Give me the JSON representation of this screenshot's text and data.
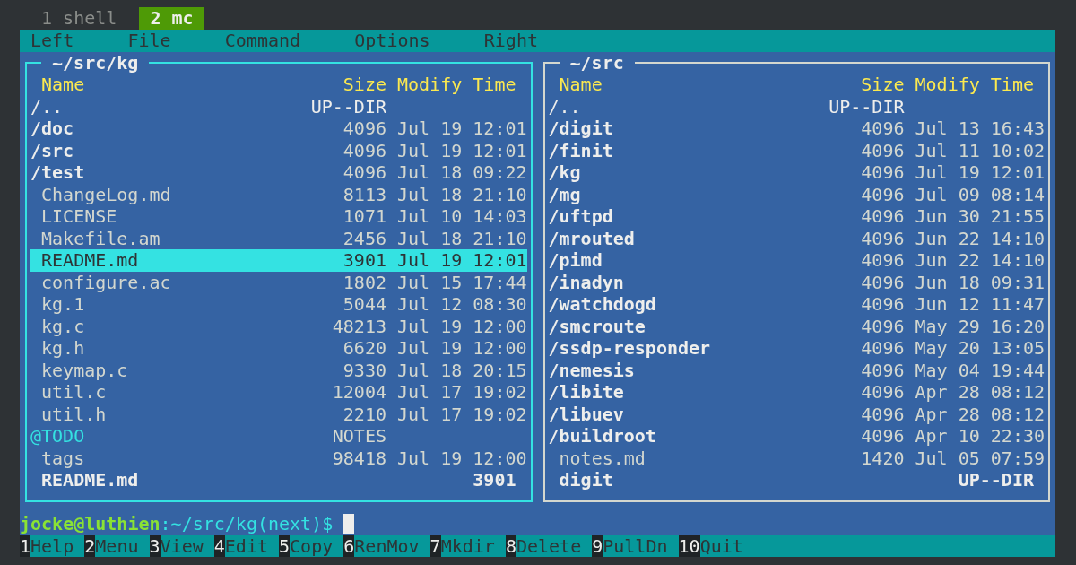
{
  "tabs": [
    {
      "label": "1 shell",
      "selected": false
    },
    {
      "label": "2 mc",
      "selected": true
    }
  ],
  "menu": [
    "Left",
    "File",
    "Command",
    "Options",
    "Right"
  ],
  "panels": [
    {
      "path": "~/src/kg",
      "active": true,
      "columns": [
        "Name",
        "Size",
        "Modify Time"
      ],
      "rows": [
        {
          "kind": "updir",
          "name": "/..",
          "size": "UP--DIR",
          "selected": false
        },
        {
          "kind": "dir",
          "name": "/doc",
          "size": "4096",
          "modified": "Jul 19 12:01",
          "selected": false
        },
        {
          "kind": "dir",
          "name": "/src",
          "size": "4096",
          "modified": "Jul 19 12:01",
          "selected": false
        },
        {
          "kind": "dir",
          "name": "/test",
          "size": "4096",
          "modified": "Jul 18 09:22",
          "selected": false
        },
        {
          "kind": "file",
          "name": "ChangeLog.md",
          "size": "8113",
          "modified": "Jul 18 21:10",
          "selected": false
        },
        {
          "kind": "file",
          "name": "LICENSE",
          "size": "1071",
          "modified": "Jul 10 14:03",
          "selected": false
        },
        {
          "kind": "file",
          "name": "Makefile.am",
          "size": "2456",
          "modified": "Jul 18 21:10",
          "selected": false
        },
        {
          "kind": "file",
          "name": "README.md",
          "size": "3901",
          "modified": "Jul 19 12:01",
          "selected": true
        },
        {
          "kind": "file",
          "name": "configure.ac",
          "size": "1802",
          "modified": "Jul 15 17:44",
          "selected": false
        },
        {
          "kind": "file",
          "name": "kg.1",
          "size": "5044",
          "modified": "Jul 12 08:30",
          "selected": false
        },
        {
          "kind": "file",
          "name": "kg.c",
          "size": "48213",
          "modified": "Jul 19 12:00",
          "selected": false
        },
        {
          "kind": "file",
          "name": "kg.h",
          "size": "6620",
          "modified": "Jul 19 12:00",
          "selected": false
        },
        {
          "kind": "file",
          "name": "keymap.c",
          "size": "9330",
          "modified": "Jul 18 20:15",
          "selected": false
        },
        {
          "kind": "file",
          "name": "util.c",
          "size": "12004",
          "modified": "Jul 17 19:02",
          "selected": false
        },
        {
          "kind": "file",
          "name": "util.h",
          "size": "2210",
          "modified": "Jul 17 19:02",
          "selected": false
        },
        {
          "kind": "special",
          "name": "@TODO",
          "size": "NOTES",
          "selected": false
        },
        {
          "kind": "file",
          "name": "tags",
          "size": "98418",
          "modified": "Jul 19 12:00",
          "selected": false
        }
      ],
      "mini_status": {
        "name": "README.md",
        "size": "3901"
      }
    },
    {
      "path": "~/src",
      "active": false,
      "columns": [
        "Name",
        "Size",
        "Modify Time"
      ],
      "rows": [
        {
          "kind": "updir",
          "name": "/..",
          "size": "UP--DIR",
          "selected": false
        },
        {
          "kind": "dir",
          "name": "/digit",
          "size": "4096",
          "modified": "Jul 13 16:43",
          "selected": false
        },
        {
          "kind": "dir",
          "name": "/finit",
          "size": "4096",
          "modified": "Jul 11 10:02",
          "selected": false
        },
        {
          "kind": "dir",
          "name": "/kg",
          "size": "4096",
          "modified": "Jul 19 12:01",
          "selected": false
        },
        {
          "kind": "dir",
          "name": "/mg",
          "size": "4096",
          "modified": "Jul 09 08:14",
          "selected": false
        },
        {
          "kind": "dir",
          "name": "/uftpd",
          "size": "4096",
          "modified": "Jun 30 21:55",
          "selected": false
        },
        {
          "kind": "dir",
          "name": "/mrouted",
          "size": "4096",
          "modified": "Jun 22 14:10",
          "selected": false
        },
        {
          "kind": "dir",
          "name": "/pimd",
          "size": "4096",
          "modified": "Jun 22 14:10",
          "selected": false
        },
        {
          "kind": "dir",
          "name": "/inadyn",
          "size": "4096",
          "modified": "Jun 18 09:31",
          "selected": false
        },
        {
          "kind": "dir",
          "name": "/watchdogd",
          "size": "4096",
          "modified": "Jun 12 11:47",
          "selected": false
        },
        {
          "kind": "dir",
          "name": "/smcroute",
          "size": "4096",
          "modified": "May 29 16:20",
          "selected": false
        },
        {
          "kind": "dir",
          "name": "/ssdp-responder",
          "size": "4096",
          "modified": "May 20 13:05",
          "selected": false
        },
        {
          "kind": "dir",
          "name": "/nemesis",
          "size": "4096",
          "modified": "May 04 19:44",
          "selected": false
        },
        {
          "kind": "dir",
          "name": "/libite",
          "size": "4096",
          "modified": "Apr 28 08:12",
          "selected": false
        },
        {
          "kind": "dir",
          "name": "/libuev",
          "size": "4096",
          "modified": "Apr 28 08:12",
          "selected": false
        },
        {
          "kind": "dir",
          "name": "/buildroot",
          "size": "4096",
          "modified": "Apr 10 22:30",
          "selected": false
        },
        {
          "kind": "file",
          "name": "notes.md",
          "size": "1420",
          "modified": "Jul 05 07:59",
          "selected": false
        }
      ],
      "mini_status": {
        "name": "digit",
        "size": "UP--DIR"
      }
    }
  ],
  "prompt": {
    "user_host": "jocke@luthien",
    "path": ":~/src/kg(next)$"
  },
  "function_keys": [
    {
      "key": "1",
      "label": "Help"
    },
    {
      "key": "2",
      "label": "Menu"
    },
    {
      "key": "3",
      "label": "View"
    },
    {
      "key": "4",
      "label": "Edit"
    },
    {
      "key": "5",
      "label": "Copy"
    },
    {
      "key": "6",
      "label": "RenMov"
    },
    {
      "key": "7",
      "label": "Mkdir"
    },
    {
      "key": "8",
      "label": "Delete"
    },
    {
      "key": "9",
      "label": "PullDn"
    },
    {
      "key": "10",
      "label": "Quit"
    }
  ]
}
